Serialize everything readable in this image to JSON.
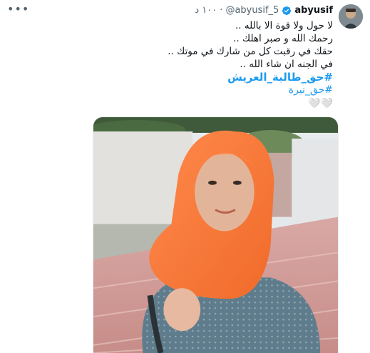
{
  "tweet": {
    "more_icon": "more-horizontal-icon",
    "display_name": "abyusif",
    "verified_icon": "verified-badge-icon",
    "handle": "@abyusif_5",
    "separator": "·",
    "time": "١٠٠ د",
    "lines": [
      "لا حول ولا قوة الا بالله ..",
      "رحمك الله و صبر اهلك ..",
      "حقك في رقبت كل من شارك في موتك ..",
      "في الجنه ان شاء الله .."
    ],
    "hashtag_primary": "#حق_طالبة_العريش",
    "hashtag_secondary": "#حق_نيرة",
    "emoji": "🤍🤍",
    "colors": {
      "link": "#1d9bf0",
      "verified": "#1d9bf0",
      "secondary_text": "#536471"
    }
  },
  "media": {
    "photo_icon": "photo-icon"
  }
}
